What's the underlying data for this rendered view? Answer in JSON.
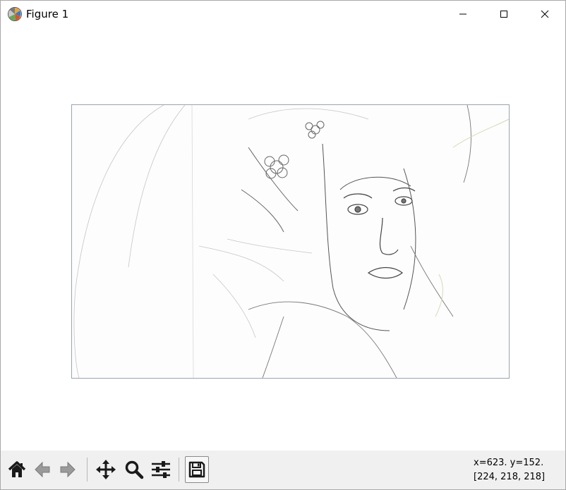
{
  "window": {
    "title": "Figure 1",
    "app_icon": "matplotlib-logo-icon",
    "controls": [
      "minimize-icon",
      "maximize-icon",
      "close-icon"
    ]
  },
  "figure": {
    "content": "pencil-sketch-portrait-image"
  },
  "toolbar": {
    "buttons": [
      {
        "name": "home",
        "icon": "home-icon"
      },
      {
        "name": "back",
        "icon": "arrow-left-icon"
      },
      {
        "name": "forward",
        "icon": "arrow-right-icon"
      },
      {
        "name": "pan",
        "icon": "move-arrows-icon"
      },
      {
        "name": "zoom",
        "icon": "magnifier-icon"
      },
      {
        "name": "configure",
        "icon": "sliders-icon"
      },
      {
        "name": "save",
        "icon": "floppy-disk-icon"
      }
    ],
    "coords_line1": "x=623. y=152.",
    "coords_line2": "[224, 218, 218]"
  },
  "colors": {
    "toolbar_bg": "#f0f0f0",
    "frame_border": "#9aa4b0",
    "icon_dark": "#1a1a1a",
    "icon_disabled": "#9a9a9a"
  }
}
